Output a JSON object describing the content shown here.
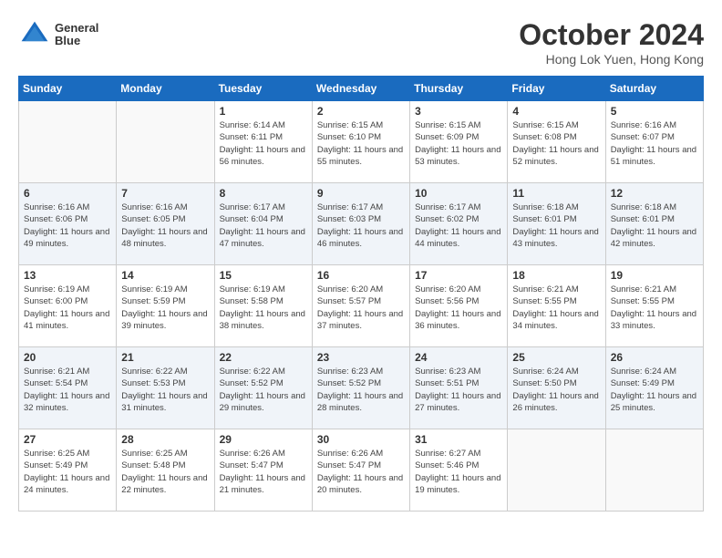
{
  "header": {
    "logo_line1": "General",
    "logo_line2": "Blue",
    "month_year": "October 2024",
    "location": "Hong Lok Yuen, Hong Kong"
  },
  "weekdays": [
    "Sunday",
    "Monday",
    "Tuesday",
    "Wednesday",
    "Thursday",
    "Friday",
    "Saturday"
  ],
  "weeks": [
    [
      {
        "day": "",
        "info": ""
      },
      {
        "day": "",
        "info": ""
      },
      {
        "day": "1",
        "info": "Sunrise: 6:14 AM\nSunset: 6:11 PM\nDaylight: 11 hours and 56 minutes."
      },
      {
        "day": "2",
        "info": "Sunrise: 6:15 AM\nSunset: 6:10 PM\nDaylight: 11 hours and 55 minutes."
      },
      {
        "day": "3",
        "info": "Sunrise: 6:15 AM\nSunset: 6:09 PM\nDaylight: 11 hours and 53 minutes."
      },
      {
        "day": "4",
        "info": "Sunrise: 6:15 AM\nSunset: 6:08 PM\nDaylight: 11 hours and 52 minutes."
      },
      {
        "day": "5",
        "info": "Sunrise: 6:16 AM\nSunset: 6:07 PM\nDaylight: 11 hours and 51 minutes."
      }
    ],
    [
      {
        "day": "6",
        "info": "Sunrise: 6:16 AM\nSunset: 6:06 PM\nDaylight: 11 hours and 49 minutes."
      },
      {
        "day": "7",
        "info": "Sunrise: 6:16 AM\nSunset: 6:05 PM\nDaylight: 11 hours and 48 minutes."
      },
      {
        "day": "8",
        "info": "Sunrise: 6:17 AM\nSunset: 6:04 PM\nDaylight: 11 hours and 47 minutes."
      },
      {
        "day": "9",
        "info": "Sunrise: 6:17 AM\nSunset: 6:03 PM\nDaylight: 11 hours and 46 minutes."
      },
      {
        "day": "10",
        "info": "Sunrise: 6:17 AM\nSunset: 6:02 PM\nDaylight: 11 hours and 44 minutes."
      },
      {
        "day": "11",
        "info": "Sunrise: 6:18 AM\nSunset: 6:01 PM\nDaylight: 11 hours and 43 minutes."
      },
      {
        "day": "12",
        "info": "Sunrise: 6:18 AM\nSunset: 6:01 PM\nDaylight: 11 hours and 42 minutes."
      }
    ],
    [
      {
        "day": "13",
        "info": "Sunrise: 6:19 AM\nSunset: 6:00 PM\nDaylight: 11 hours and 41 minutes."
      },
      {
        "day": "14",
        "info": "Sunrise: 6:19 AM\nSunset: 5:59 PM\nDaylight: 11 hours and 39 minutes."
      },
      {
        "day": "15",
        "info": "Sunrise: 6:19 AM\nSunset: 5:58 PM\nDaylight: 11 hours and 38 minutes."
      },
      {
        "day": "16",
        "info": "Sunrise: 6:20 AM\nSunset: 5:57 PM\nDaylight: 11 hours and 37 minutes."
      },
      {
        "day": "17",
        "info": "Sunrise: 6:20 AM\nSunset: 5:56 PM\nDaylight: 11 hours and 36 minutes."
      },
      {
        "day": "18",
        "info": "Sunrise: 6:21 AM\nSunset: 5:55 PM\nDaylight: 11 hours and 34 minutes."
      },
      {
        "day": "19",
        "info": "Sunrise: 6:21 AM\nSunset: 5:55 PM\nDaylight: 11 hours and 33 minutes."
      }
    ],
    [
      {
        "day": "20",
        "info": "Sunrise: 6:21 AM\nSunset: 5:54 PM\nDaylight: 11 hours and 32 minutes."
      },
      {
        "day": "21",
        "info": "Sunrise: 6:22 AM\nSunset: 5:53 PM\nDaylight: 11 hours and 31 minutes."
      },
      {
        "day": "22",
        "info": "Sunrise: 6:22 AM\nSunset: 5:52 PM\nDaylight: 11 hours and 29 minutes."
      },
      {
        "day": "23",
        "info": "Sunrise: 6:23 AM\nSunset: 5:52 PM\nDaylight: 11 hours and 28 minutes."
      },
      {
        "day": "24",
        "info": "Sunrise: 6:23 AM\nSunset: 5:51 PM\nDaylight: 11 hours and 27 minutes."
      },
      {
        "day": "25",
        "info": "Sunrise: 6:24 AM\nSunset: 5:50 PM\nDaylight: 11 hours and 26 minutes."
      },
      {
        "day": "26",
        "info": "Sunrise: 6:24 AM\nSunset: 5:49 PM\nDaylight: 11 hours and 25 minutes."
      }
    ],
    [
      {
        "day": "27",
        "info": "Sunrise: 6:25 AM\nSunset: 5:49 PM\nDaylight: 11 hours and 24 minutes."
      },
      {
        "day": "28",
        "info": "Sunrise: 6:25 AM\nSunset: 5:48 PM\nDaylight: 11 hours and 22 minutes."
      },
      {
        "day": "29",
        "info": "Sunrise: 6:26 AM\nSunset: 5:47 PM\nDaylight: 11 hours and 21 minutes."
      },
      {
        "day": "30",
        "info": "Sunrise: 6:26 AM\nSunset: 5:47 PM\nDaylight: 11 hours and 20 minutes."
      },
      {
        "day": "31",
        "info": "Sunrise: 6:27 AM\nSunset: 5:46 PM\nDaylight: 11 hours and 19 minutes."
      },
      {
        "day": "",
        "info": ""
      },
      {
        "day": "",
        "info": ""
      }
    ]
  ]
}
